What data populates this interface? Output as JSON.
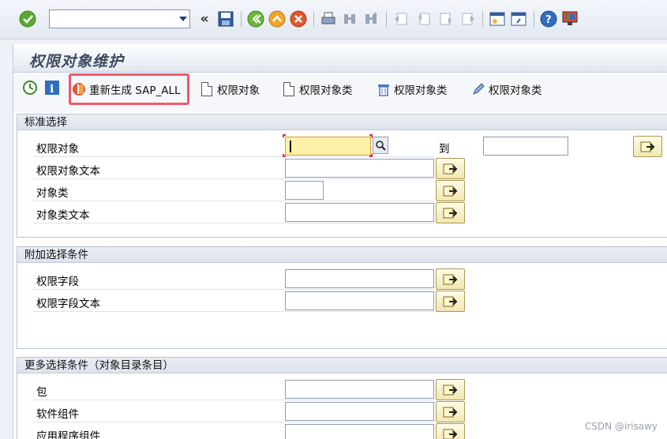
{
  "system_toolbar": {
    "command_field_value": "",
    "icons": [
      "enter-check-icon",
      "back-icon",
      "save-icon",
      "back-green-icon",
      "exit-icon",
      "cancel-icon",
      "print-icon",
      "find-icon",
      "find-next-icon",
      "first-page-icon",
      "prev-page-icon",
      "next-page-icon",
      "last-page-icon",
      "create-session-icon",
      "shortcut-icon",
      "help-icon",
      "layout-menu-icon"
    ],
    "back_symbol": "«"
  },
  "title": "权限对象维护",
  "app_toolbar": {
    "regenerate_label": "重新生成 SAP_ALL",
    "create_object_label": "权限对象",
    "create_class_label": "权限对象类",
    "delete_class_label": "权限对象类",
    "change_class_label": "权限对象类"
  },
  "groups": {
    "standard": {
      "title": "标准选择",
      "fields": [
        {
          "label": "权限对象",
          "value": ""
        },
        {
          "label": "权限对象文本",
          "value": ""
        },
        {
          "label": "对象类",
          "value": ""
        },
        {
          "label": "对象类文本",
          "value": ""
        }
      ],
      "to_label": "到",
      "to_value": ""
    },
    "additional": {
      "title": "附加选择条件",
      "fields": [
        {
          "label": "权限字段",
          "value": ""
        },
        {
          "label": "权限字段文本",
          "value": ""
        }
      ]
    },
    "more": {
      "title": "更多选择条件（对象目录条目）",
      "fields": [
        {
          "label": "包",
          "value": ""
        },
        {
          "label": "软件组件",
          "value": ""
        },
        {
          "label": "应用程序组件",
          "value": ""
        }
      ]
    }
  },
  "watermark": "CSDN @irisawy",
  "colors": {
    "required_field": "#fff1a8",
    "highlight_box": "#ee5a6a",
    "group_header": "#dde3ed"
  }
}
